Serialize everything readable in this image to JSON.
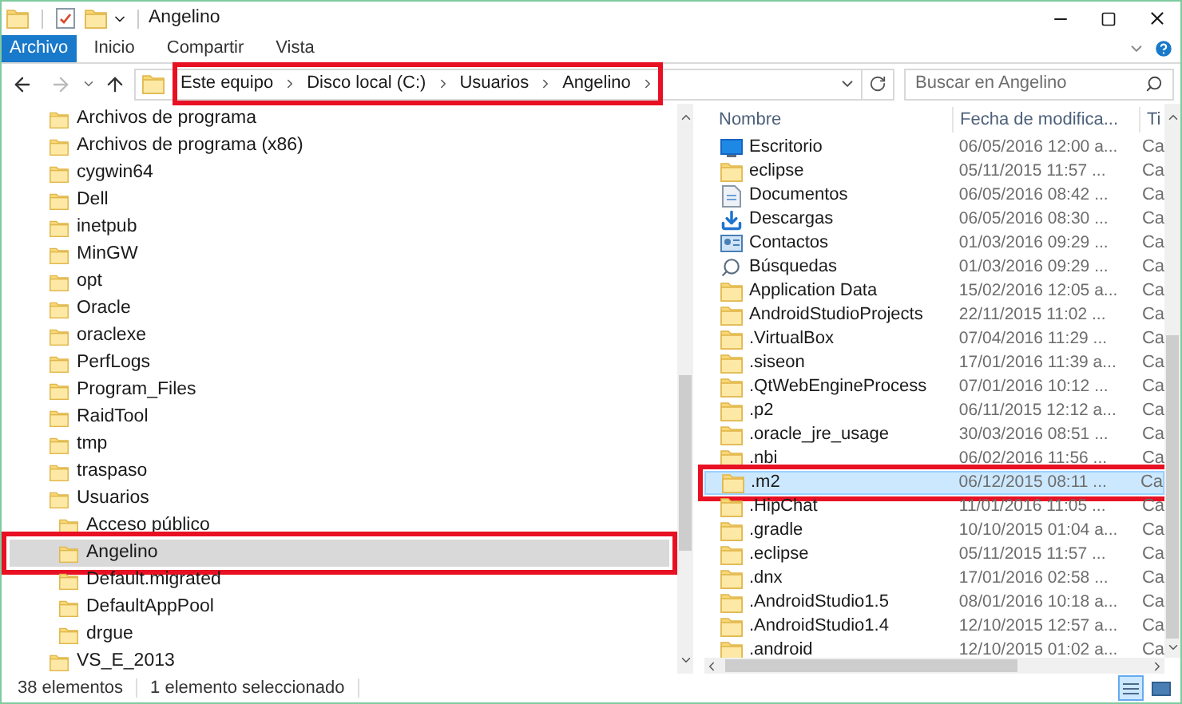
{
  "window": {
    "title": "Angelino"
  },
  "ribbon_tabs": [
    {
      "label": "Archivo",
      "kind": "file"
    },
    {
      "label": "Inicio",
      "kind": "tab"
    },
    {
      "label": "Compartir",
      "kind": "tab"
    },
    {
      "label": "Vista",
      "kind": "tab"
    }
  ],
  "address_bar": {
    "breadcrumb": [
      "Este equipo",
      "Disco local (C:)",
      "Usuarios",
      "Angelino"
    ],
    "highlighted": true
  },
  "search": {
    "placeholder": "Buscar en Angelino"
  },
  "tree": [
    {
      "label": "Archivos de programa",
      "selected": false,
      "highlighted": false
    },
    {
      "label": "Archivos de programa (x86)",
      "selected": false,
      "highlighted": false
    },
    {
      "label": "cygwin64",
      "selected": false,
      "highlighted": false
    },
    {
      "label": "Dell",
      "selected": false,
      "highlighted": false
    },
    {
      "label": "inetpub",
      "selected": false,
      "highlighted": false
    },
    {
      "label": "MinGW",
      "selected": false,
      "highlighted": false
    },
    {
      "label": "opt",
      "selected": false,
      "highlighted": false
    },
    {
      "label": "Oracle",
      "selected": false,
      "highlighted": false
    },
    {
      "label": "oraclexe",
      "selected": false,
      "highlighted": false
    },
    {
      "label": "PerfLogs",
      "selected": false,
      "highlighted": false
    },
    {
      "label": "Program_Files",
      "selected": false,
      "highlighted": false
    },
    {
      "label": "RaidTool",
      "selected": false,
      "highlighted": false
    },
    {
      "label": "tmp",
      "selected": false,
      "highlighted": false
    },
    {
      "label": "traspaso",
      "selected": false,
      "highlighted": false
    },
    {
      "label": "Usuarios",
      "selected": false,
      "highlighted": false,
      "children": [
        {
          "label": "Acceso público",
          "selected": false,
          "highlighted": false
        },
        {
          "label": "Angelino",
          "selected": true,
          "highlighted": true
        },
        {
          "label": "Default.migrated",
          "selected": false,
          "highlighted": false
        },
        {
          "label": "DefaultAppPool",
          "selected": false,
          "highlighted": false
        },
        {
          "label": "drgue",
          "selected": false,
          "highlighted": false
        }
      ]
    },
    {
      "label": "VS_E_2013",
      "selected": false,
      "highlighted": false
    }
  ],
  "file_list": {
    "columns": [
      "Nombre",
      "Fecha de modifica...",
      "Ti"
    ],
    "rows": [
      {
        "name": "Escritorio",
        "date": "06/05/2016 12:00 a...",
        "type": "Ca",
        "kind": "desktop",
        "selected": false,
        "highlighted": false
      },
      {
        "name": "eclipse",
        "date": "05/11/2015 11:57 ...",
        "type": "Ca",
        "kind": "folder",
        "selected": false,
        "highlighted": false
      },
      {
        "name": "Documentos",
        "date": "06/05/2016 08:42 ...",
        "type": "Ca",
        "kind": "documents",
        "selected": false,
        "highlighted": false
      },
      {
        "name": "Descargas",
        "date": "06/05/2016 08:30 ...",
        "type": "Ca",
        "kind": "downloads",
        "selected": false,
        "highlighted": false
      },
      {
        "name": "Contactos",
        "date": "01/03/2016 09:29 ...",
        "type": "Ca",
        "kind": "contacts",
        "selected": false,
        "highlighted": false
      },
      {
        "name": "Búsquedas",
        "date": "01/03/2016 09:29 ...",
        "type": "Ca",
        "kind": "searches",
        "selected": false,
        "highlighted": false
      },
      {
        "name": "Application Data",
        "date": "15/02/2016 12:05 a...",
        "type": "Ca",
        "kind": "folder",
        "selected": false,
        "highlighted": false
      },
      {
        "name": "AndroidStudioProjects",
        "date": "22/11/2015 11:02 ...",
        "type": "Ca",
        "kind": "folder",
        "selected": false,
        "highlighted": false
      },
      {
        "name": ".VirtualBox",
        "date": "07/04/2016 11:29 ...",
        "type": "Ca",
        "kind": "folder",
        "selected": false,
        "highlighted": false
      },
      {
        "name": ".siseon",
        "date": "17/01/2016 11:39 a...",
        "type": "Ca",
        "kind": "folder",
        "selected": false,
        "highlighted": false
      },
      {
        "name": ".QtWebEngineProcess",
        "date": "07/01/2016 10:12 ...",
        "type": "Ca",
        "kind": "folder",
        "selected": false,
        "highlighted": false
      },
      {
        "name": ".p2",
        "date": "06/11/2015 12:12 a...",
        "type": "Ca",
        "kind": "folder",
        "selected": false,
        "highlighted": false
      },
      {
        "name": ".oracle_jre_usage",
        "date": "30/03/2016 08:51 ...",
        "type": "Ca",
        "kind": "folder",
        "selected": false,
        "highlighted": false
      },
      {
        "name": ".nbi",
        "date": "06/02/2016 11:56 ...",
        "type": "Ca",
        "kind": "folder",
        "selected": false,
        "highlighted": false
      },
      {
        "name": ".m2",
        "date": "06/12/2015 08:11 ...",
        "type": "Ca",
        "kind": "folder",
        "selected": true,
        "highlighted": true
      },
      {
        "name": ".HipChat",
        "date": "11/01/2016 11:05 ...",
        "type": "Ca",
        "kind": "folder",
        "selected": false,
        "highlighted": false
      },
      {
        "name": ".gradle",
        "date": "10/10/2015 01:04 a...",
        "type": "Ca",
        "kind": "folder",
        "selected": false,
        "highlighted": false
      },
      {
        "name": ".eclipse",
        "date": "05/11/2015 11:57 ...",
        "type": "Ca",
        "kind": "folder",
        "selected": false,
        "highlighted": false
      },
      {
        "name": ".dnx",
        "date": "17/01/2016 02:58 ...",
        "type": "Ca",
        "kind": "folder",
        "selected": false,
        "highlighted": false
      },
      {
        "name": ".AndroidStudio1.5",
        "date": "08/01/2016 10:18 a...",
        "type": "Ca",
        "kind": "folder",
        "selected": false,
        "highlighted": false
      },
      {
        "name": ".AndroidStudio1.4",
        "date": "12/10/2015 12:57 a...",
        "type": "Ca",
        "kind": "folder",
        "selected": false,
        "highlighted": false
      },
      {
        "name": ".android",
        "date": "12/10/2015 01:02 a...",
        "type": "Ca",
        "kind": "folder",
        "selected": false,
        "highlighted": false
      }
    ]
  },
  "status_bar": {
    "item_count": "38 elementos",
    "selection": "1 elemento seleccionado"
  }
}
